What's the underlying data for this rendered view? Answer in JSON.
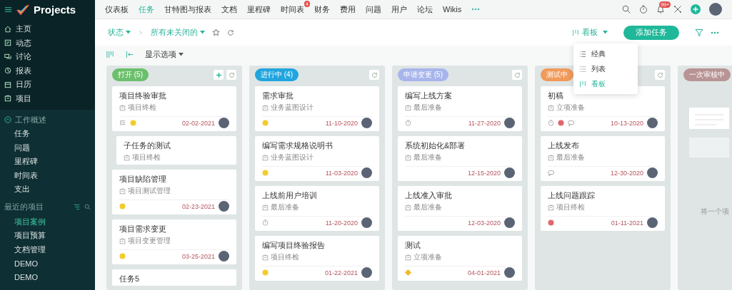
{
  "sidebar": {
    "app_name": "Projects",
    "items": [
      {
        "label": "主页",
        "kind": "home"
      },
      {
        "label": "动态",
        "kind": "feed"
      },
      {
        "label": "讨论",
        "kind": "chat"
      },
      {
        "label": "报表",
        "kind": "report"
      },
      {
        "label": "日历",
        "kind": "calendar"
      },
      {
        "label": "项目",
        "kind": "project"
      }
    ],
    "section": {
      "label": "工作概述",
      "expanded": true,
      "children": [
        {
          "label": "任务"
        },
        {
          "label": "问题"
        },
        {
          "label": "里程碑"
        },
        {
          "label": "时间表"
        },
        {
          "label": "支出"
        }
      ]
    },
    "recent": {
      "label": "最近的项目",
      "items": [
        {
          "label": "项目案例",
          "selected": true
        },
        {
          "label": "项目预算",
          "selected": false
        },
        {
          "label": "文档管理",
          "selected": false
        },
        {
          "label": "DEMO",
          "selected": false
        },
        {
          "label": "DEMO",
          "selected": false
        }
      ]
    }
  },
  "top_nav": {
    "tabs": [
      {
        "label": "仪表板",
        "selected": false
      },
      {
        "label": "任务",
        "selected": true
      },
      {
        "label": "甘特图与报表",
        "selected": false
      },
      {
        "label": "文档",
        "selected": false
      },
      {
        "label": "里程碑",
        "selected": false
      },
      {
        "label": "时间表",
        "selected": false,
        "badge": "4"
      },
      {
        "label": "财务",
        "selected": false
      },
      {
        "label": "费用",
        "selected": false
      },
      {
        "label": "问题",
        "selected": false
      },
      {
        "label": "用户",
        "selected": false
      },
      {
        "label": "论坛",
        "selected": false
      },
      {
        "label": "Wikis",
        "selected": false
      }
    ],
    "notification_badge": "99+"
  },
  "filter_bar": {
    "status": "状态",
    "filter": "所有未关闭的",
    "view": "看板",
    "add_button": "添加任务"
  },
  "toolbar": {
    "display_options": "显示选项"
  },
  "view_menu": [
    {
      "label": "经典",
      "kind": "classic",
      "selected": false
    },
    {
      "label": "列表",
      "kind": "list",
      "selected": false
    },
    {
      "label": "看板",
      "kind": "board",
      "selected": true
    }
  ],
  "columns": [
    {
      "label": "打开 (5)",
      "color": "#6cbf6c",
      "addable": true,
      "cards": [
        {
          "kind": "task",
          "title": "项目终验审批",
          "project": "项目终检",
          "icons": [
            {
              "kind": "subtask"
            },
            {
              "kind": "medium"
            }
          ],
          "date": "02-02-2021"
        },
        {
          "kind": "subtask",
          "title": "子任务的测试",
          "project": "项目终检"
        },
        {
          "kind": "task",
          "title": "项目缺陷管理",
          "project": "项目测试管理",
          "icons": [
            {
              "kind": "medium"
            }
          ],
          "date": "02-23-2021"
        },
        {
          "kind": "task",
          "title": "项目需求变更",
          "project": "项目变更管理",
          "icons": [
            {
              "kind": "medium"
            }
          ],
          "date": "03-25-2021"
        },
        {
          "kind": "task",
          "title": "任务5"
        }
      ]
    },
    {
      "label": "进行中 (4)",
      "color": "#21a5de",
      "addable": false,
      "cards": [
        {
          "kind": "task",
          "title": "需求审批",
          "project": "业务蓝图设计",
          "icons": [
            {
              "kind": "medium"
            }
          ],
          "date": "11-10-2020"
        },
        {
          "kind": "task",
          "title": "编写需求规格说明书",
          "project": "业务蓝图设计",
          "icons": [
            {
              "kind": "medium"
            }
          ],
          "date": "11-03-2020"
        },
        {
          "kind": "task",
          "title": "上线前用户培训",
          "project": "最后准备",
          "icons": [
            {
              "kind": "timer"
            }
          ],
          "date": "11-20-2020"
        },
        {
          "kind": "task",
          "title": "编写项目终验报告",
          "project": "项目终检",
          "icons": [
            {
              "kind": "medium"
            }
          ],
          "date": "01-22-2021"
        }
      ]
    },
    {
      "label": "申请变更 (5)",
      "color": "#a8b5ec",
      "addable": false,
      "cards": [
        {
          "kind": "task",
          "title": "编写上线方案",
          "project": "最后准备",
          "icons": [
            {
              "kind": "timer"
            }
          ],
          "date": "11-27-2020"
        },
        {
          "kind": "task",
          "title": "系统初始化&部署",
          "project": "最后准备",
          "date": "12-15-2020"
        },
        {
          "kind": "task",
          "title": "上线准入审批",
          "project": "最后准备",
          "date": "12-03-2020"
        },
        {
          "kind": "task",
          "title": "测试",
          "project": "立项准备",
          "icons": [
            {
              "kind": "milestone"
            }
          ],
          "date": "04-01-2021"
        }
      ]
    },
    {
      "label": "测试中",
      "color": "#f09a5a",
      "addable": false,
      "cards": [
        {
          "kind": "task",
          "title": "初稿",
          "project": "立项准备",
          "icons": [
            {
              "kind": "timer"
            },
            {
              "kind": "high"
            },
            {
              "kind": "comment"
            }
          ],
          "date": "10-13-2020"
        },
        {
          "kind": "task",
          "title": "上线发布",
          "project": "最后准备",
          "icons": [
            {
              "kind": "comment"
            }
          ],
          "date": "12-30-2020"
        },
        {
          "kind": "task",
          "title": "上线问题跟踪",
          "project": "项目终检",
          "icons": [
            {
              "kind": "high"
            }
          ],
          "date": "01-11-2021"
        }
      ]
    },
    {
      "label": "一次审核中",
      "color": "#b89494",
      "addable": false,
      "empty_text": "将一个项"
    }
  ]
}
